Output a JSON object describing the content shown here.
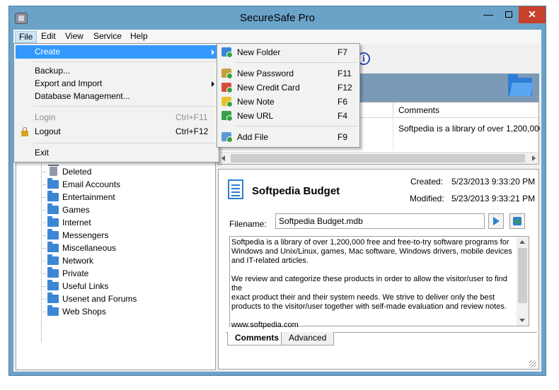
{
  "window": {
    "title": "SecureSafe Pro",
    "controls": {
      "minimize": "—",
      "close": "✕"
    }
  },
  "menubar": {
    "file": "File",
    "edit": "Edit",
    "view": "View",
    "service": "Service",
    "help": "Help"
  },
  "file_menu": {
    "create": "Create",
    "backup": "Backup...",
    "export_import": "Export and Import",
    "db_management": "Database Management...",
    "login": "Login",
    "login_shortcut": "Ctrl+F11",
    "logout": "Logout",
    "logout_shortcut": "Ctrl+F12",
    "exit": "Exit"
  },
  "create_submenu": {
    "items": [
      {
        "label": "New Folder",
        "shortcut": "F7"
      },
      {
        "label": "New Password",
        "shortcut": "F11"
      },
      {
        "label": "New Credit Card",
        "shortcut": "F12"
      },
      {
        "label": "New Note",
        "shortcut": "F6"
      },
      {
        "label": "New URL",
        "shortcut": "F4"
      },
      {
        "label": "Add File",
        "shortcut": "F9"
      }
    ]
  },
  "tree": {
    "items": [
      "Deleted",
      "Email Accounts",
      "Entertainment",
      "Games",
      "Internet",
      "Messengers",
      "Miscellaneous",
      "Network",
      "Private",
      "Useful Links",
      "Usenet and Forums",
      "Web Shops"
    ]
  },
  "list": {
    "col_comments": "Comments",
    "row_comments": "Softpedia is a library of over 1,200,000"
  },
  "detail": {
    "title": "Softpedia Budget",
    "created_label": "Created:",
    "created_value": "5/23/2013 9:33:20 PM",
    "modified_label": "Modified:",
    "modified_value": "5/23/2013 9:33:21 PM",
    "filename_label": "Filename:",
    "filename_value": "Softpedia Budget.mdb",
    "comment_text": "Softpedia is a library of over 1,200,000 free and free-to-try software programs for\nWindows and Unix/Linux, games, Mac software, Windows drivers, mobile devices\nand IT-related articles.\n\nWe review and categorize these products in order to allow the visitor/user to find the\nexact product their and their system needs. We strive to deliver only the best\nproducts to the visitor/user together with self-made evaluation and review notes.\n\nwww.softpedia.com",
    "tab_comments": "Comments",
    "tab_advanced": "Advanced"
  },
  "icons": {
    "info": "i"
  },
  "colors": {
    "highlight": "#3399ff",
    "close_button": "#c7402c",
    "frame": "#6ba3c8",
    "header_band": "#7b9ab8",
    "folder": "#3d86d4"
  }
}
